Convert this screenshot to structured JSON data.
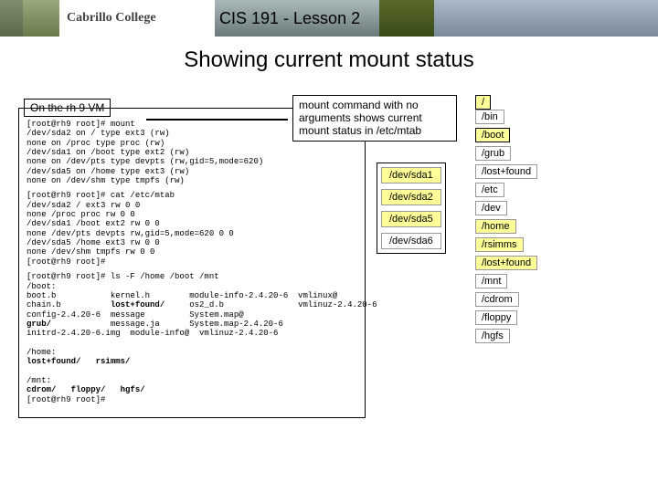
{
  "header": {
    "logo_text": "Cabrillo College",
    "course_title": "CIS 191 - Lesson 2"
  },
  "slide_title": "Showing current mount status",
  "terminal": {
    "caption": "On the rh 9 VM",
    "block1": "[root@rh9 root]# mount\n/dev/sda2 on / type ext3 (rw)\nnone on /proc type proc (rw)\n/dev/sda1 on /boot type ext2 (rw)\nnone on /dev/pts type devpts (rw,gid=5,mode=620)\n/dev/sda5 on /home type ext3 (rw)\nnone on /dev/shm type tmpfs (rw)",
    "block2": "[root@rh9 root]# cat /etc/mtab\n/dev/sda2 / ext3 rw 0 0\nnone /proc proc rw 0 0\n/dev/sda1 /boot ext2 rw 0 0\nnone /dev/pts devpts rw,gid=5,mode=620 0 0\n/dev/sda5 /home ext3 rw 0 0\nnone /dev/shm tmpfs rw 0 0\n[root@rh9 root]#",
    "block3_prefix": "[root@rh9 root]# ls -F /home /boot /mnt\n/boot:\nboot.b           kernel.h        module-info-2.4.20-6  vmlinux@\nchain.b          ",
    "block3_lost": "lost+found/",
    "block3_mid1": "     os2_d.b               vmlinuz-2.4.20-6\nconfig-2.4.20-6  message         System.map@\n",
    "block3_grub": "grub/",
    "block3_mid2": "            message.ja      System.map-2.4.20-6\ninitrd-2.4.20-6.img  module-info@  vmlinuz-2.4.20-6\n\n/home:\n",
    "block3_lost2": "lost+found/",
    "block3_mid3": "   ",
    "block3_rsimms": "rsimms/",
    "block3_mid4": "\n\n/mnt:\n",
    "block3_cdrom": "cdrom/",
    "block3_sp1": "   ",
    "block3_floppy": "floppy/",
    "block3_sp2": "   ",
    "block3_hgfs": "hgfs/",
    "block3_tail": "\n[root@rh9 root]#"
  },
  "note": "mount command with no arguments shows current mount status in /etc/mtab",
  "devices": [
    "/dev/sda1",
    "/dev/sda2",
    "/dev/sda5",
    "/dev/sda6"
  ],
  "tree": {
    "root": "/",
    "bin": "/bin",
    "boot": "/boot",
    "grub": "/grub",
    "boot_lost": "/lost+found",
    "etc": "/etc",
    "dev": "/dev",
    "home": "/home",
    "rsimms": "/rsimms",
    "home_lost": "/lost+found",
    "mnt": "/mnt",
    "cdrom": "/cdrom",
    "floppy": "/floppy",
    "hgfs": "/hgfs"
  }
}
